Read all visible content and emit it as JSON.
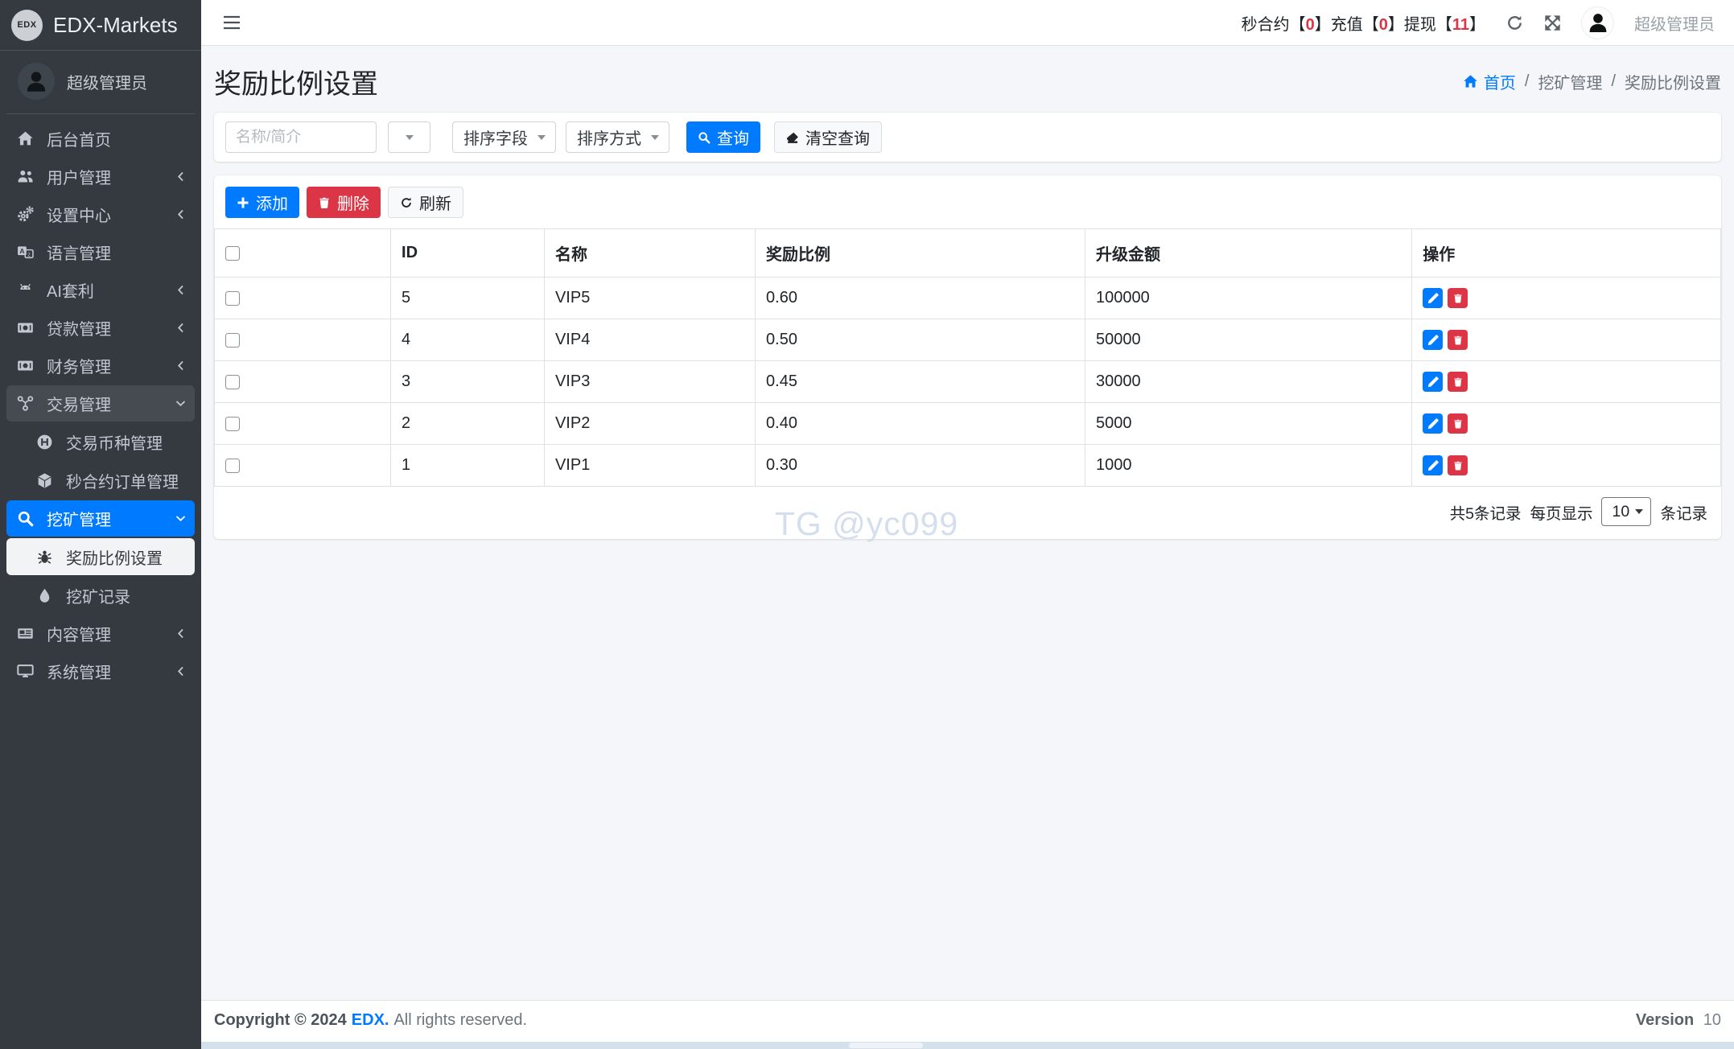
{
  "brand": {
    "logo_text": "EDX",
    "name": "EDX-Markets"
  },
  "sidebar": {
    "user_name": "超级管理员",
    "items": [
      {
        "label": "后台首页",
        "icon": "home"
      },
      {
        "label": "用户管理",
        "icon": "users"
      },
      {
        "label": "设置中心",
        "icon": "gears"
      },
      {
        "label": "语言管理",
        "icon": "language"
      },
      {
        "label": "AI套利",
        "icon": "android"
      },
      {
        "label": "贷款管理",
        "icon": "money-bill"
      },
      {
        "label": "财务管理",
        "icon": "money-bill"
      },
      {
        "label": "交易管理",
        "icon": "transfer",
        "children": [
          {
            "label": "交易币种管理",
            "icon": "h-circle"
          },
          {
            "label": "秒合约订单管理",
            "icon": "cube"
          }
        ]
      },
      {
        "label": "挖矿管理",
        "icon": "search",
        "children": [
          {
            "label": "奖励比例设置",
            "icon": "bug"
          },
          {
            "label": "挖矿记录",
            "icon": "droplet"
          }
        ]
      },
      {
        "label": "内容管理",
        "icon": "newspaper"
      },
      {
        "label": "系统管理",
        "icon": "desktop"
      }
    ]
  },
  "topbar": {
    "bracket_open": "【",
    "bracket_close": "】",
    "stats": [
      {
        "label": "秒合约",
        "value": "0"
      },
      {
        "label": "充值",
        "value": "0"
      },
      {
        "label": "提现",
        "value": "11"
      }
    ],
    "user_name": "超级管理员"
  },
  "page": {
    "title": "奖励比例设置",
    "breadcrumb_home": "首页",
    "breadcrumb_separator": "/",
    "breadcrumb_items": [
      "挖矿管理",
      "奖励比例设置"
    ]
  },
  "filters": {
    "search_placeholder": "名称/简介",
    "sort_field": "排序字段",
    "sort_order": "排序方式",
    "query": "查询",
    "clear": "清空查询"
  },
  "toolbar": {
    "add": "添加",
    "delete": "删除",
    "refresh": "刷新"
  },
  "table": {
    "headers": {
      "id": "ID",
      "name": "名称",
      "ratio": "奖励比例",
      "amount": "升级金额",
      "actions": "操作"
    },
    "rows": [
      {
        "id": "5",
        "name": "VIP5",
        "ratio": "0.60",
        "amount": "100000"
      },
      {
        "id": "4",
        "name": "VIP4",
        "ratio": "0.50",
        "amount": "50000"
      },
      {
        "id": "3",
        "name": "VIP3",
        "ratio": "0.45",
        "amount": "30000"
      },
      {
        "id": "2",
        "name": "VIP2",
        "ratio": "0.40",
        "amount": "5000"
      },
      {
        "id": "1",
        "name": "VIP1",
        "ratio": "0.30",
        "amount": "1000"
      }
    ]
  },
  "pagination": {
    "total": "共5条记录",
    "per_page_prefix": "每页显示",
    "per_page": "10",
    "per_page_suffix": "条记录"
  },
  "watermark": "TG @yc099",
  "footer": {
    "copyright": "Copyright © 2024",
    "brand": "EDX.",
    "rights": "All rights reserved.",
    "version_label": "Version",
    "version": "10"
  },
  "colors": {
    "primary": "#007bff",
    "danger": "#dc3545",
    "sidebar_bg": "#343a40",
    "content_bg": "#f4f6f9",
    "stat_number": "#dc3545",
    "watermark": "#d4deec"
  }
}
